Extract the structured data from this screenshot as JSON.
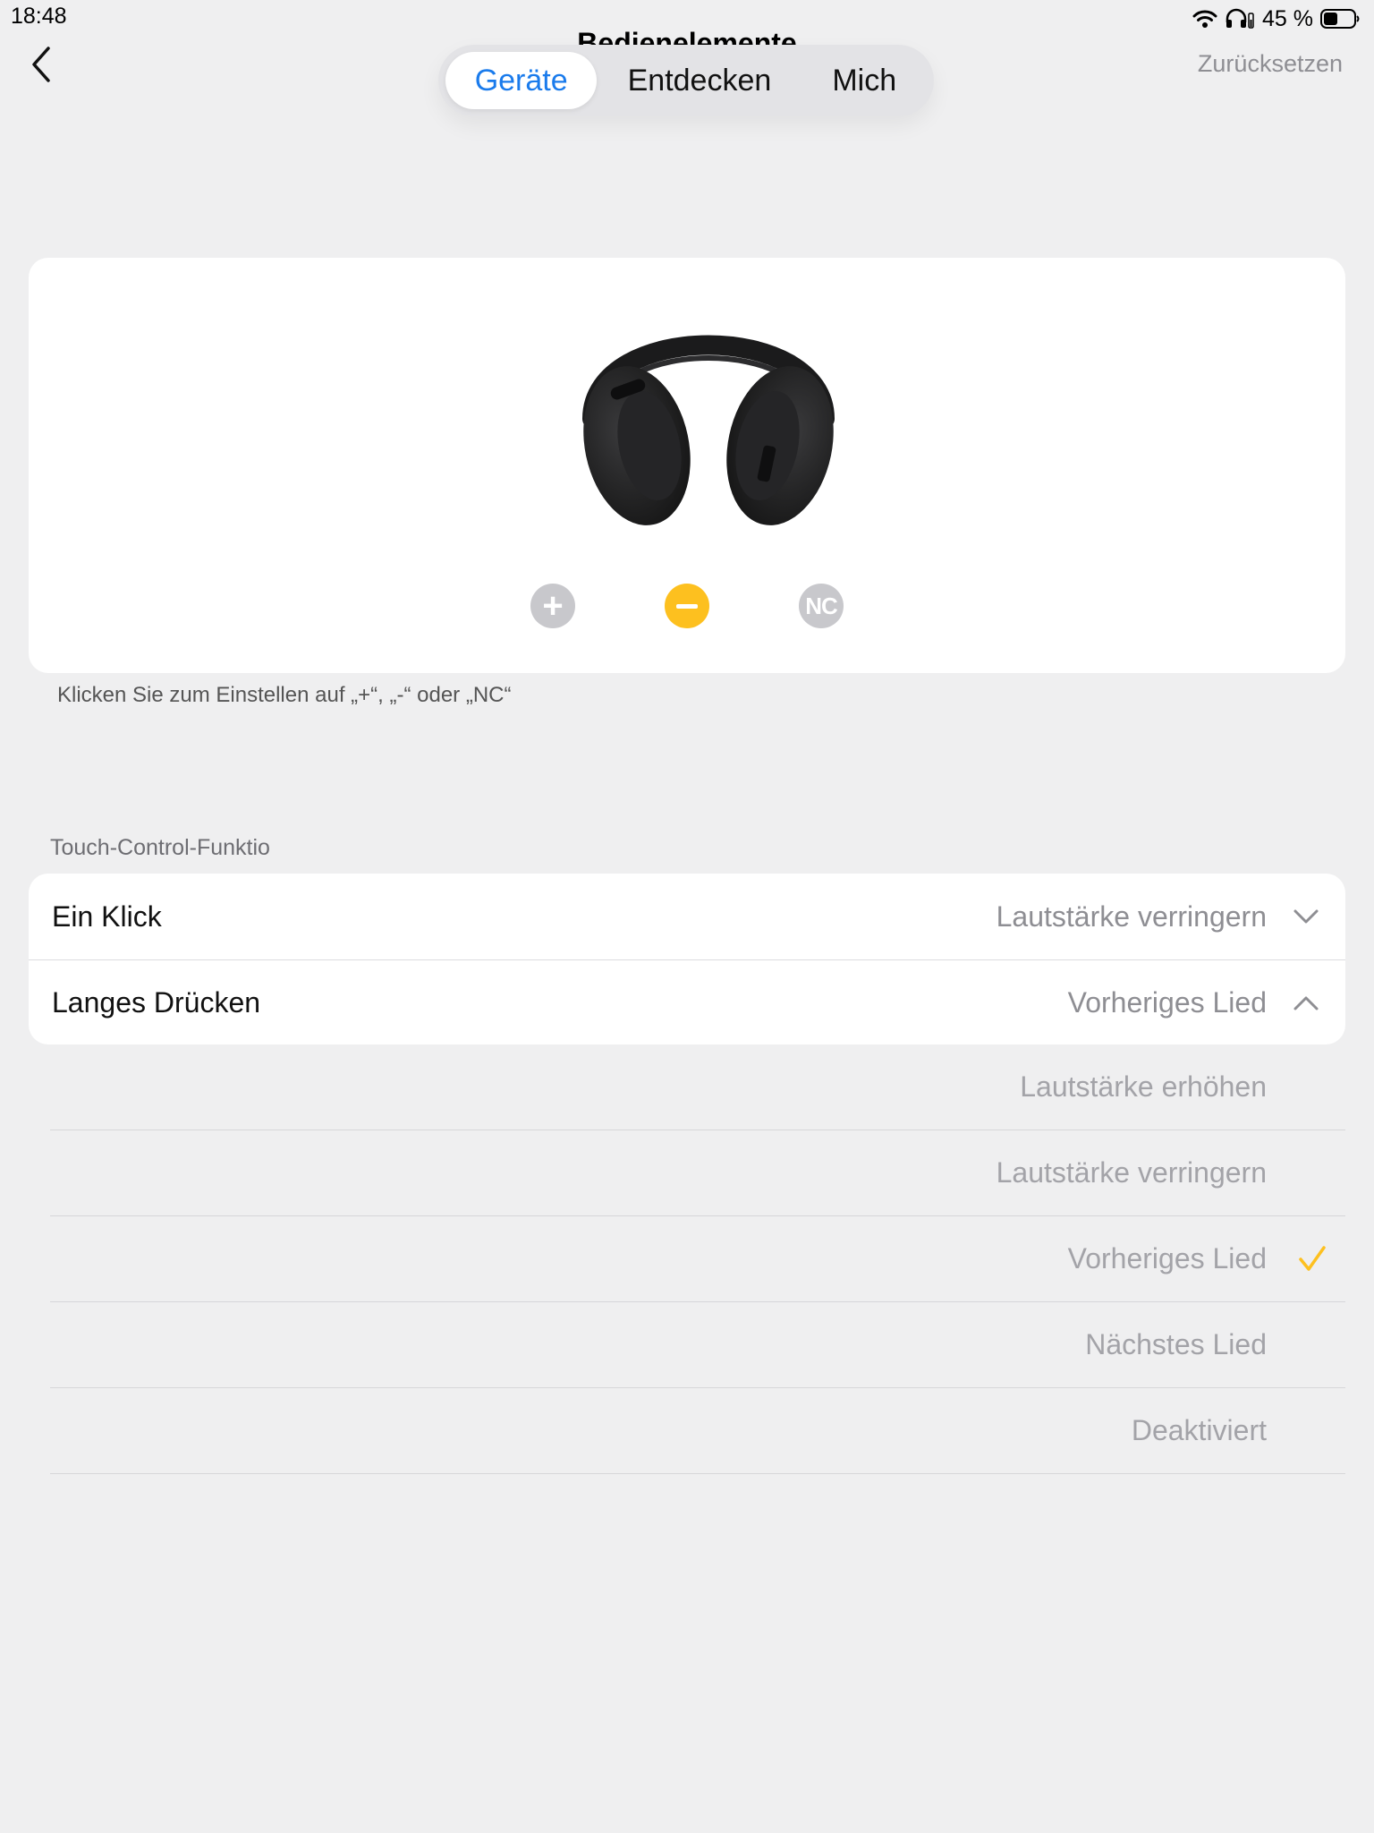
{
  "status": {
    "time": "18:48",
    "battery": "45 %",
    "icons": [
      "wifi-icon",
      "headphones-status-icon",
      "battery-icon"
    ]
  },
  "nav": {
    "title": "Bedienelemente",
    "reset_label": "Zurücksetzen",
    "tabs": [
      {
        "label": "Geräte",
        "active": true
      },
      {
        "label": "Entdecken",
        "active": false
      },
      {
        "label": "Mich",
        "active": false
      }
    ]
  },
  "device": {
    "controls": [
      {
        "label": "+",
        "selected": false
      },
      {
        "label": "−",
        "selected": true
      },
      {
        "label": "NC",
        "selected": false
      }
    ],
    "hint": "Klicken Sie zum Einstellen auf „+“, „-“ oder „NC“"
  },
  "touch": {
    "section_label": "Touch-Control-Funktio",
    "rows": [
      {
        "label": "Ein Klick",
        "value": "Lautstärke verringern",
        "expanded": false
      },
      {
        "label": "Langes Drücken",
        "value": "Vorheriges Lied",
        "expanded": true
      }
    ],
    "options": [
      {
        "label": "Lautstärke erhöhen",
        "selected": false
      },
      {
        "label": "Lautstärke verringern",
        "selected": false
      },
      {
        "label": "Vorheriges Lied",
        "selected": true
      },
      {
        "label": "Nächstes Lied",
        "selected": false
      },
      {
        "label": "Deaktiviert",
        "selected": false
      }
    ]
  },
  "colors": {
    "accent_blue": "#1a7bec",
    "accent_yellow": "#fdc01f",
    "background": "#efeff0"
  }
}
